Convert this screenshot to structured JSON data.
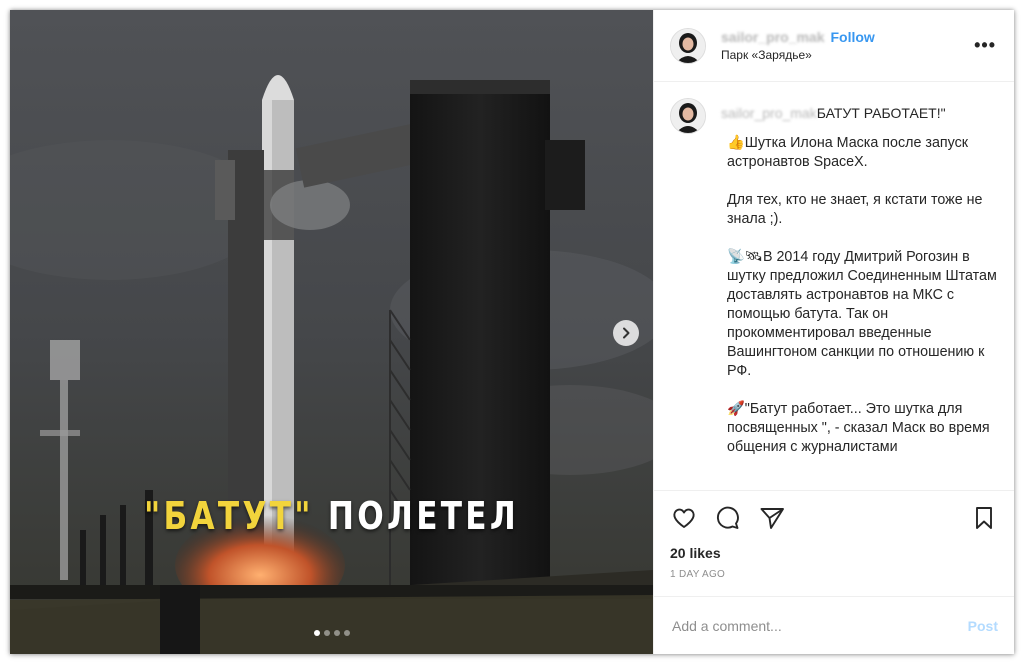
{
  "media": {
    "overlay_quoted": "\"БАТУТ\"",
    "overlay_rest": " ПОЛЕТЕЛ",
    "slides_total": 4,
    "slide_active": 1
  },
  "header": {
    "username": "sailor_pro_mak",
    "follow_label": "Follow",
    "location": "Парк «Зарядье»",
    "more_label": "•••"
  },
  "caption": {
    "username": "sailor_pro_mak",
    "headline": "БАТУТ РАБОТАЕТ!\"",
    "paragraphs": [
      "👍Шутка Илона Маска после запуск астронавтов SpaceX.",
      "Для тех, кто не знает, я кстати тоже не знала ;).",
      "📡🛰В 2014 году Дмитрий Рогозин в шутку предложил Соединенным Штатам доставлять астронавтов на МКС с помощью батута. Так он прокомментировал введенные Вашингтоном санкции по отношению к РФ.",
      "🚀\"Батут работает... Это шутка для посвященных \", - сказал Маск во время общения с журналистами"
    ]
  },
  "actions": {
    "icons": [
      "heart-icon",
      "comment-icon",
      "share-icon",
      "bookmark-icon"
    ]
  },
  "likes_text": "20 likes",
  "timestamp": "1 DAY AGO",
  "comment": {
    "placeholder": "Add a comment...",
    "post_label": "Post"
  },
  "colors": {
    "accent": "#3897f0",
    "post_disabled": "#b3dbff",
    "overlay_yellow": "#f2d43c"
  }
}
